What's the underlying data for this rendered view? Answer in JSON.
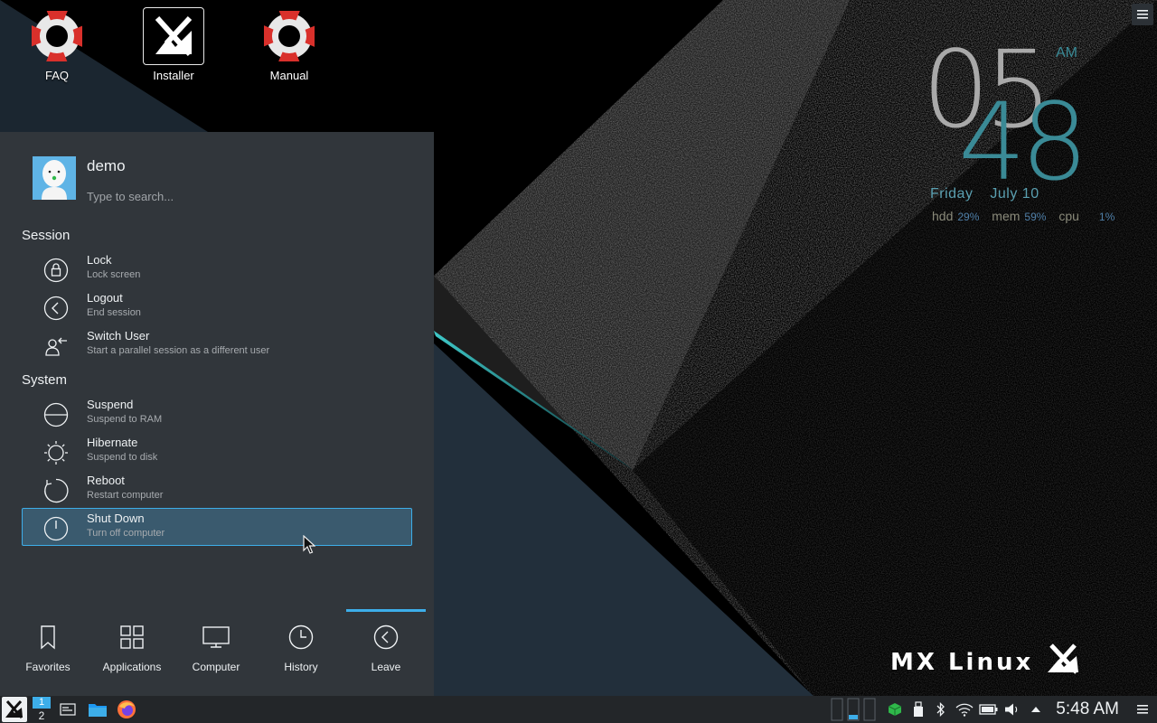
{
  "desktop": {
    "icons": [
      {
        "label": "FAQ",
        "icon": "lifebuoy-icon"
      },
      {
        "label": "Installer",
        "icon": "mx-installer-icon"
      },
      {
        "label": "Manual",
        "icon": "lifebuoy-icon"
      }
    ]
  },
  "clock_widget": {
    "hour": "05",
    "minute": "48",
    "ampm": "AM",
    "weekday": "Friday",
    "date": "July 10",
    "stats": [
      {
        "label": "hdd",
        "value": "29%"
      },
      {
        "label": "mem",
        "value": "59%"
      },
      {
        "label": "cpu",
        "value": "1%"
      }
    ]
  },
  "logo": {
    "text": "MX Linux"
  },
  "launcher": {
    "user": {
      "name": "demo"
    },
    "search": {
      "placeholder": "Type to search..."
    },
    "sections": [
      {
        "title": "Session",
        "items": [
          {
            "name": "Lock",
            "desc": "Lock screen",
            "icon": "lock-icon"
          },
          {
            "name": "Logout",
            "desc": "End session",
            "icon": "logout-icon"
          },
          {
            "name": "Switch User",
            "desc": "Start a parallel session as a different user",
            "icon": "switch-user-icon"
          }
        ]
      },
      {
        "title": "System",
        "items": [
          {
            "name": "Suspend",
            "desc": "Suspend to RAM",
            "icon": "suspend-icon"
          },
          {
            "name": "Hibernate",
            "desc": "Suspend to disk",
            "icon": "hibernate-icon"
          },
          {
            "name": "Reboot",
            "desc": "Restart computer",
            "icon": "reboot-icon"
          },
          {
            "name": "Shut Down",
            "desc": "Turn off computer",
            "icon": "power-icon",
            "active": true
          }
        ]
      }
    ],
    "tabs": [
      {
        "label": "Favorites",
        "icon": "bookmark-icon"
      },
      {
        "label": "Applications",
        "icon": "grid-icon"
      },
      {
        "label": "Computer",
        "icon": "monitor-icon"
      },
      {
        "label": "History",
        "icon": "clock-icon"
      },
      {
        "label": "Leave",
        "icon": "leave-icon",
        "active": true
      }
    ]
  },
  "taskbar": {
    "pager": {
      "desktop1": "1",
      "desktop2": "2"
    },
    "time": "5:48 AM"
  },
  "colors": {
    "accent": "#3daee9",
    "panel": "#31363b",
    "taskbar": "#232629",
    "clock_minute": "#3a8a96"
  }
}
